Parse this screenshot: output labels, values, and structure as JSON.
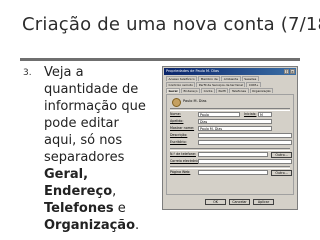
{
  "slide": {
    "title": "Criação de uma nova conta (7/18)",
    "bullet_number": "3.",
    "bullet_lines": [
      "Veja a",
      "quantidade de",
      "informação que",
      "pode editar",
      "aqui, só nos",
      "separadores"
    ],
    "bullet_bold_1": "Geral,",
    "bullet_bold_2": "Endereço",
    "bullet_sep_2": ",",
    "bullet_bold_3": "Telefones",
    "bullet_sep_3": " e",
    "bullet_bold_4": "Organização",
    "bullet_end": "."
  },
  "dialog": {
    "title": "Propriedades de Paulo M. Dias",
    "help_button": "?",
    "close_button": "×",
    "tabs_row1": [
      "Acesso telefónico",
      "Membro de",
      "Ambiente",
      "Sessões"
    ],
    "tabs_row2": [
      "Controlo remoto",
      "Perfil de Serviços de terminal",
      "COM+"
    ],
    "tabs_row3": [
      "Geral",
      "Endereço",
      "Conta",
      "Perfil",
      "Telefones",
      "Organização"
    ],
    "active_tab": "Geral",
    "user_name": "Paulo M. Dias",
    "fields": {
      "first_name_label": "Nome:",
      "first_name_value": "Paulo",
      "initials_label": "Iniciais:",
      "initials_value": "M",
      "last_name_label": "Apelido:",
      "last_name_value": "Dias",
      "display_name_label": "Mostrar nome:",
      "display_name_value": "Paulo M. Dias",
      "description_label": "Descrição:",
      "description_value": "",
      "office_label": "Escritório:",
      "office_value": "",
      "phone_label": "N.º de telefone:",
      "phone_value": "",
      "email_label": "Correio electrónico:",
      "email_value": "",
      "web_label": "Página Web:",
      "web_value": ""
    },
    "other_button": "Outro...",
    "ok_button": "OK",
    "cancel_button": "Cancelar",
    "apply_button": "Aplicar"
  }
}
